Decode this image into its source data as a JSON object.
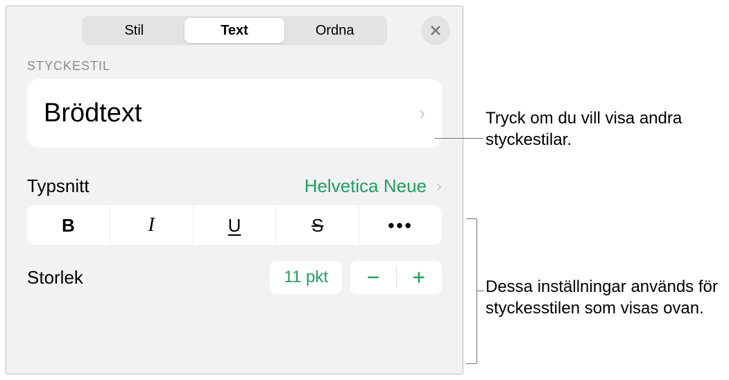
{
  "tabs": {
    "style": "Stil",
    "text": "Text",
    "arrange": "Ordna"
  },
  "section_label": "STYCKESTIL",
  "paragraph_style": {
    "current": "Brödtext"
  },
  "font": {
    "label": "Typsnitt",
    "value": "Helvetica Neue"
  },
  "format_buttons": {
    "bold": "B",
    "italic": "I",
    "underline": "U",
    "strike": "S",
    "more": "•••"
  },
  "size": {
    "label": "Storlek",
    "value": "11 pkt"
  },
  "callouts": {
    "styles_hint": "Tryck om du vill visa andra styckestilar.",
    "settings_hint": "Dessa inställningar används för styckesstilen som visas ovan."
  }
}
